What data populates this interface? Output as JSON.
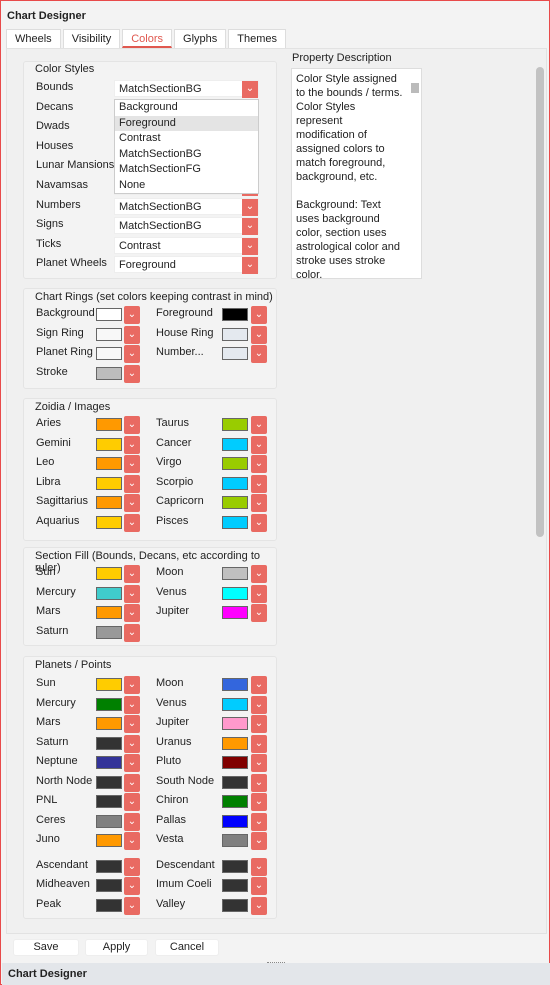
{
  "window": {
    "title": "Chart Designer",
    "footer_title": "Chart Designer"
  },
  "tabs": [
    {
      "label": "Wheels"
    },
    {
      "label": "Visibility"
    },
    {
      "label": "Colors",
      "active": true
    },
    {
      "label": "Glyphs"
    },
    {
      "label": "Themes"
    }
  ],
  "accent": "#e96a62",
  "color_styles": {
    "title": "Color Styles",
    "rows": [
      {
        "label": "Bounds",
        "value": "MatchSectionBG"
      },
      {
        "label": "Decans",
        "value": ""
      },
      {
        "label": "Dwads",
        "value": ""
      },
      {
        "label": "Houses",
        "value": ""
      },
      {
        "label": "Lunar Mansions",
        "value": ""
      },
      {
        "label": "Navamsas",
        "value": ""
      },
      {
        "label": "Numbers",
        "value": "MatchSectionBG"
      },
      {
        "label": "Signs",
        "value": "MatchSectionBG"
      },
      {
        "label": "Ticks",
        "value": "Contrast"
      },
      {
        "label": "Planet Wheels",
        "value": "Foreground"
      }
    ],
    "dropdown_options": [
      "Background",
      "Foreground",
      "Contrast",
      "MatchSectionBG",
      "MatchSectionFG",
      "None"
    ],
    "dropdown_highlighted": "Foreground"
  },
  "property": {
    "label": "Property Description",
    "text": "Color Style assigned to the bounds / terms. Color Styles represent modification of assigned colors to match foreground, background, etc.\n\nBackground: Text uses background color, section uses astrological color and stroke uses stroke color."
  },
  "groups": [
    {
      "title": "Chart Rings (set colors keeping contrast in mind)",
      "rows": [
        [
          {
            "label": "Background",
            "color": "#ffffff"
          },
          {
            "label": "Foreground",
            "color": "#000000"
          }
        ],
        [
          {
            "label": "Sign Ring",
            "color": "#f8f8f8"
          },
          {
            "label": "House Ring",
            "color": "#e4e9ef"
          }
        ],
        [
          {
            "label": "Planet Ring",
            "color": "#f8f8f8"
          },
          {
            "label": "Number...",
            "color": "#e4e9ef"
          }
        ],
        [
          {
            "label": "Stroke",
            "color": "#bdbdbd"
          }
        ]
      ]
    },
    {
      "title": "Zoidia / Images",
      "rows": [
        [
          {
            "label": "Aries",
            "color": "#ff9900"
          },
          {
            "label": "Taurus",
            "color": "#99cc00"
          }
        ],
        [
          {
            "label": "Gemini",
            "color": "#ffcc00"
          },
          {
            "label": "Cancer",
            "color": "#00ccff"
          }
        ],
        [
          {
            "label": "Leo",
            "color": "#ff9900"
          },
          {
            "label": "Virgo",
            "color": "#99cc00"
          }
        ],
        [
          {
            "label": "Libra",
            "color": "#ffcc00"
          },
          {
            "label": "Scorpio",
            "color": "#00ccff"
          }
        ],
        [
          {
            "label": "Sagittarius",
            "color": "#ff9900"
          },
          {
            "label": "Capricorn",
            "color": "#99cc00"
          }
        ],
        [
          {
            "label": "Aquarius",
            "color": "#ffcc00"
          },
          {
            "label": "Pisces",
            "color": "#00ccff"
          }
        ]
      ]
    },
    {
      "title": "Section Fill (Bounds, Decans, etc according to ruler)",
      "rows": [
        [
          {
            "label": "Sun",
            "color": "#ffcc00"
          },
          {
            "label": "Moon",
            "color": "#c0c0c0"
          }
        ],
        [
          {
            "label": "Mercury",
            "color": "#40cccc"
          },
          {
            "label": "Venus",
            "color": "#00ffff"
          }
        ],
        [
          {
            "label": "Mars",
            "color": "#ff9900"
          },
          {
            "label": "Jupiter",
            "color": "#ff00ff"
          }
        ],
        [
          {
            "label": "Saturn",
            "color": "#999999"
          }
        ]
      ]
    },
    {
      "title": "Planets / Points",
      "rows": [
        [
          {
            "label": "Sun",
            "color": "#ffcc00"
          },
          {
            "label": "Moon",
            "color": "#3366dd"
          }
        ],
        [
          {
            "label": "Mercury",
            "color": "#008000"
          },
          {
            "label": "Venus",
            "color": "#00ccff"
          }
        ],
        [
          {
            "label": "Mars",
            "color": "#ff9900"
          },
          {
            "label": "Jupiter",
            "color": "#ff99cc"
          }
        ],
        [
          {
            "label": "Saturn",
            "color": "#333333"
          },
          {
            "label": "Uranus",
            "color": "#ff9900"
          }
        ],
        [
          {
            "label": "Neptune",
            "color": "#333399"
          },
          {
            "label": "Pluto",
            "color": "#800000"
          }
        ],
        [
          {
            "label": "North Node",
            "color": "#333333"
          },
          {
            "label": "South Node",
            "color": "#333333"
          }
        ],
        [
          {
            "label": "PNL",
            "color": "#333333"
          },
          {
            "label": "Chiron",
            "color": "#008000"
          }
        ],
        [
          {
            "label": "Ceres",
            "color": "#808080"
          },
          {
            "label": "Pallas",
            "color": "#0000ff"
          }
        ],
        [
          {
            "label": "Juno",
            "color": "#ff9900"
          },
          {
            "label": "Vesta",
            "color": "#808080"
          }
        ],
        [
          {
            "label": "Ascendant",
            "color": "#333333"
          },
          {
            "label": "Descendant",
            "color": "#333333"
          }
        ],
        [
          {
            "label": "Midheaven",
            "color": "#333333"
          },
          {
            "label": "Imum Coeli",
            "color": "#333333"
          }
        ],
        [
          {
            "label": "Peak",
            "color": "#333333"
          },
          {
            "label": "Valley",
            "color": "#333333"
          }
        ]
      ]
    }
  ],
  "buttons": {
    "save": "Save",
    "apply": "Apply",
    "cancel": "Cancel"
  }
}
